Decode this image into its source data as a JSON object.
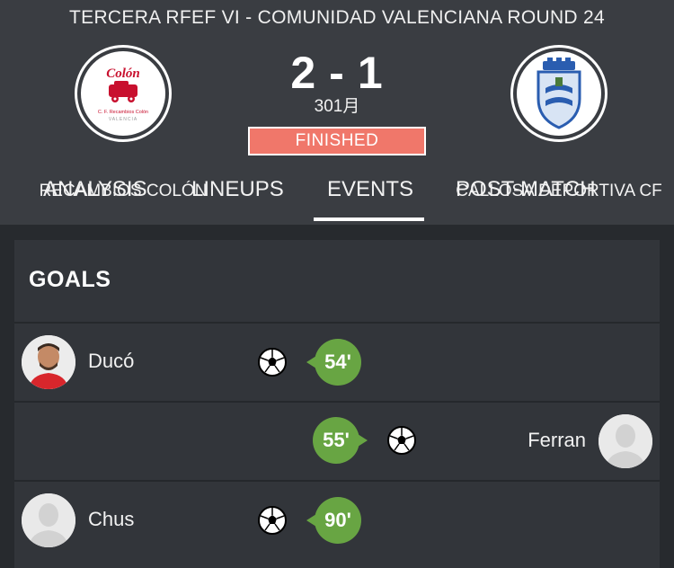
{
  "match": {
    "competition": "TERCERA RFEF  VI - COMUNIDAD VALENCIANA ROUND 24",
    "home_score": "2",
    "score_separator": "-",
    "away_score": "1",
    "date": "301月",
    "status": "FINISHED"
  },
  "home_team": {
    "name": "RECAMBIOS COLÓN",
    "crest_word": "Colón",
    "crest_line1": "C. F. Recambios Colón",
    "crest_line2": "VALENCIA",
    "crest_colors": {
      "primary": "#c8102e"
    }
  },
  "away_team": {
    "name": "CALLOSA DEPORTIVA CF",
    "crest_colors": {
      "primary": "#2a5db0",
      "secondary": "#ffffff"
    }
  },
  "tabs": [
    {
      "label": "ANALYSIS"
    },
    {
      "label": "LINEUPS"
    },
    {
      "label": "EVENTS",
      "active": true
    },
    {
      "label": "POST-MATCH"
    }
  ],
  "events": {
    "section_title": "GOALS",
    "goals": [
      {
        "player": "Ducó",
        "minute": "54'",
        "side": "home",
        "icon": "soccer-ball-icon"
      },
      {
        "player": "Ferran",
        "minute": "55'",
        "side": "away",
        "icon": "soccer-ball-icon"
      },
      {
        "player": "Chus",
        "minute": "90'",
        "side": "home",
        "icon": "soccer-ball-icon"
      }
    ]
  },
  "colors": {
    "header_bg": "#3a3d42",
    "page_bg": "#272a2e",
    "card_bg": "#32353a",
    "status_bg": "#f0776a",
    "minute_bg": "#68a543"
  }
}
